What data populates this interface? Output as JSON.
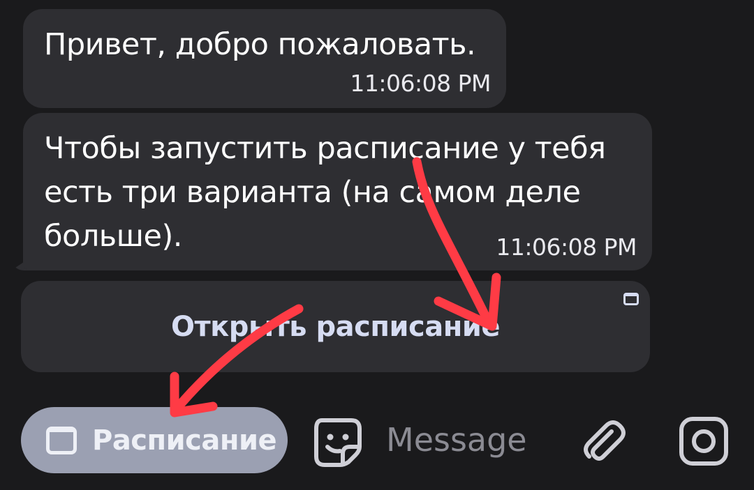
{
  "messages": [
    {
      "text": "Привет, добро пожаловать.",
      "time": "11:06:08 PM"
    },
    {
      "text": "Чтобы запустить расписание у тебя\nесть три варианта (на самом деле\nбольше).",
      "time": "11:06:08 PM"
    }
  ],
  "inline_button": {
    "label": "Открыть расписание",
    "icon": "web-app-window-icon"
  },
  "bottom_bar": {
    "menu_button_label": "Расписание",
    "menu_button_icon": "web-app-window-icon",
    "message_placeholder": "Message",
    "sticker_icon": "sticker-smile-icon",
    "attach_icon": "paperclip-icon",
    "camera_icon": "camera-icon"
  },
  "colors": {
    "background": "#1a1a1c",
    "bubble": "#2e2e32",
    "menu_button": "#9ba0b2",
    "annotation_arrow": "#ff3b45"
  }
}
